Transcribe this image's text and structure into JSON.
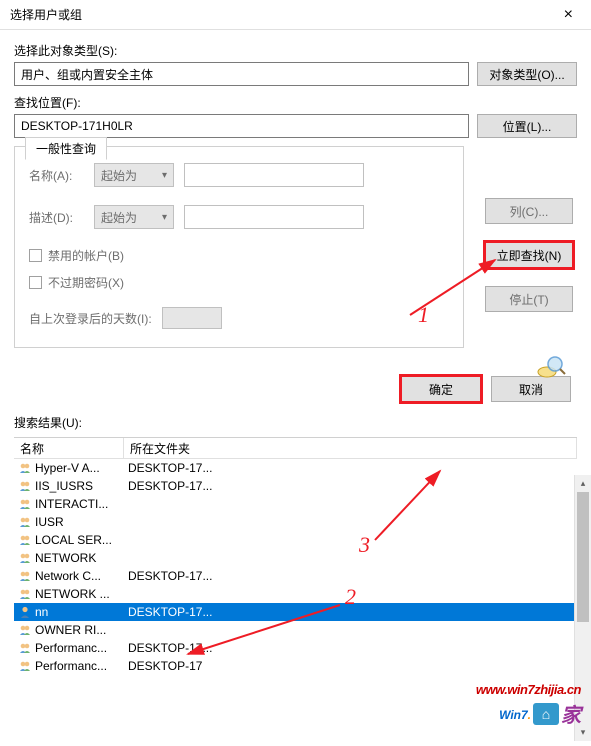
{
  "titlebar": {
    "title": "选择用户或组",
    "close": "×"
  },
  "fields": {
    "objectTypeLabel": "选择此对象类型(S):",
    "objectTypeValue": "用户、组或内置安全主体",
    "objectTypeBtn": "对象类型(O)...",
    "locationLabel": "查找位置(F):",
    "locationValue": "DESKTOP-171H0LR",
    "locationBtn": "位置(L)..."
  },
  "queryPanel": {
    "tabLabel": "一般性查询",
    "nameLabel": "名称(A):",
    "descLabel": "描述(D):",
    "comboValue": "起始为",
    "chkDisabled": "禁用的帐户(B)",
    "chkNoExpire": "不过期密码(X)",
    "daysLabel": "自上次登录后的天数(I):"
  },
  "rightButtons": {
    "columns": "列(C)...",
    "findNow": "立即查找(N)",
    "stop": "停止(T)"
  },
  "actions": {
    "ok": "确定",
    "cancel": "取消"
  },
  "resultsLabel": "搜索结果(U):",
  "table": {
    "colName": "名称",
    "colFolder": "所在文件夹",
    "rows": [
      {
        "name": "Hyper-V A...",
        "folder": "DESKTOP-17..."
      },
      {
        "name": "IIS_IUSRS",
        "folder": "DESKTOP-17..."
      },
      {
        "name": "INTERACTI...",
        "folder": ""
      },
      {
        "name": "IUSR",
        "folder": ""
      },
      {
        "name": "LOCAL SER...",
        "folder": ""
      },
      {
        "name": "NETWORK",
        "folder": ""
      },
      {
        "name": "Network C...",
        "folder": "DESKTOP-17..."
      },
      {
        "name": "NETWORK ...",
        "folder": ""
      },
      {
        "name": "nn",
        "folder": "DESKTOP-17...",
        "selected": true,
        "userIcon": true
      },
      {
        "name": "OWNER RI...",
        "folder": ""
      },
      {
        "name": "Performanc...",
        "folder": "DESKTOP-17..."
      },
      {
        "name": "Performanc...",
        "folder": "DESKTOP-17"
      }
    ]
  },
  "annotations": {
    "n1": "1",
    "n2": "2",
    "n3": "3"
  },
  "watermark": {
    "url": "www.win7zhijia.cn",
    "brand1": "Win7",
    "brand2": "家"
  }
}
